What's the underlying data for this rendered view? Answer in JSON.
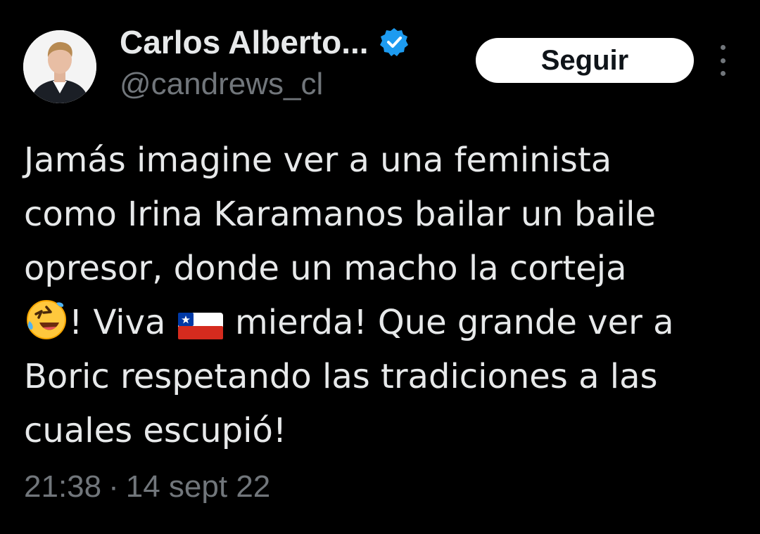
{
  "author": {
    "display_name": "Carlos Alberto...",
    "handle": "@candrews_cl",
    "verified": true,
    "verified_color": "#1d9bf0"
  },
  "actions": {
    "follow_label": "Seguir"
  },
  "tweet": {
    "line1": "Jamás imagine ver a una feminista",
    "line2": "como Irina Karamanos bailar un baile",
    "line3": "opresor, donde un macho la corteja",
    "line4_a": "! Viva",
    "line4_b": "mierda! Que grande ver a",
    "line5": "Boric respetando las tradiciones a las",
    "line6": "cuales escupió!",
    "emoji_1": "rolling-on-floor-laughing-emoji",
    "emoji_2": "chile-flag-emoji"
  },
  "meta": {
    "time": "21:38",
    "separator": "·",
    "date": "14 sept 22"
  },
  "colors": {
    "background": "#000000",
    "text_primary": "#e7e9ea",
    "text_secondary": "#71767b",
    "button_bg": "#ffffff",
    "button_text": "#0f1419"
  }
}
